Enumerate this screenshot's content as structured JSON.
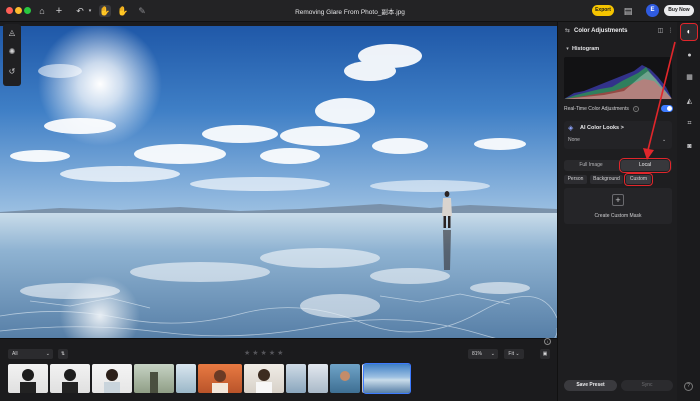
{
  "titlebar": {
    "title": "Removing Glare From Photo_副本.jpg",
    "export_label": "Export",
    "account_initial": "E",
    "buy_now_label": "Buy Now",
    "icons": [
      "home-icon",
      "plus-icon",
      "undo-icon",
      "hand-icon",
      "pan-icon",
      "brush-icon",
      "share-icon"
    ]
  },
  "left_tools": [
    "magic-icon",
    "settings-icon",
    "history-icon"
  ],
  "bottombar": {
    "filter_value": "All",
    "zoom_value": "81%",
    "fit_label": "Fit",
    "rating_stars": "★★★★★",
    "thumbnail_count": 12,
    "selected_thumbnail_index": 11
  },
  "right_panel": {
    "title": "Color Adjustments",
    "histogram_label": "Histogram",
    "realtime_label": "Real-Time Color Adjustments",
    "realtime_info": "i",
    "realtime_enabled": true,
    "ai_looks_label": "AI Color Looks",
    "ai_looks_chevron": ">",
    "looks_value": "None",
    "tabs": [
      "Full Image",
      "Local"
    ],
    "active_tab": "Local",
    "mask_types": [
      "Person",
      "Background",
      "Custom"
    ],
    "active_mask_type": "Custom",
    "create_mask_label": "Create Custom Mask",
    "save_preset_label": "Save Preset",
    "sync_label": "Sync"
  },
  "far_strip": {
    "active_icon": "color-adjustments-icon",
    "icons": [
      "color-adjustments-icon",
      "drop-icon",
      "layers-icon",
      "shirt-icon",
      "crop-icon",
      "camera-icon",
      "help-icon"
    ],
    "help_label": "?"
  },
  "colors": {
    "accent": "#3d7bff",
    "export_yellow": "#f5c400",
    "annotation_red": "#e0262b",
    "panel_bg": "#1e1e20"
  }
}
